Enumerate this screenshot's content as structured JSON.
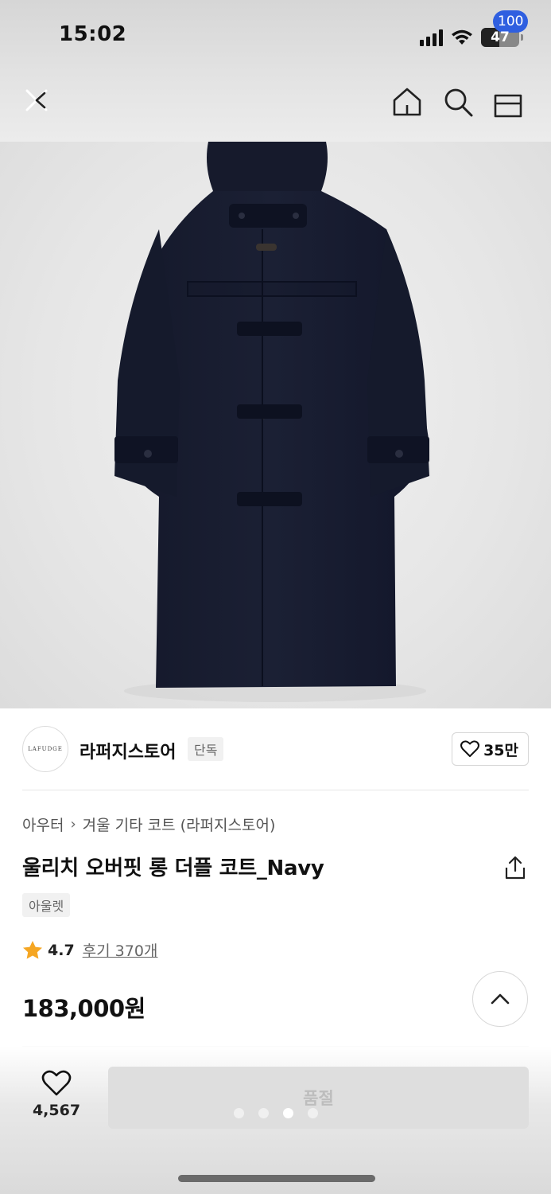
{
  "status_bar": {
    "time": "15:02",
    "battery": "47"
  },
  "nav": {
    "cart_count": "100",
    "accent_color": "#2f5fe0"
  },
  "brand": {
    "logo_text": "LAFUDGE",
    "name": "라퍼지스토어",
    "tag": "단독",
    "likes": "35만"
  },
  "product": {
    "breadcrumb": [
      "아우터",
      "겨울 기타 코트 (라퍼지스토어)"
    ],
    "title": "울리치 오버핏 롱 더플 코트_Navy",
    "outlet_tag": "아울렛",
    "rating": "4.7",
    "review_text": "후기 370개",
    "price": "183,000원",
    "star_color": "#f5a623"
  },
  "bottom_bar": {
    "like_count": "4,567",
    "soldout_label": "품절",
    "image_page_count": 4,
    "image_active_index": 2
  },
  "icons": {
    "close": "close-icon",
    "home": "home-icon",
    "search": "search-icon",
    "cart": "cart-icon",
    "heart": "heart-icon",
    "share": "share-icon",
    "star": "star-icon",
    "chevron_up": "chevron-up-icon"
  }
}
